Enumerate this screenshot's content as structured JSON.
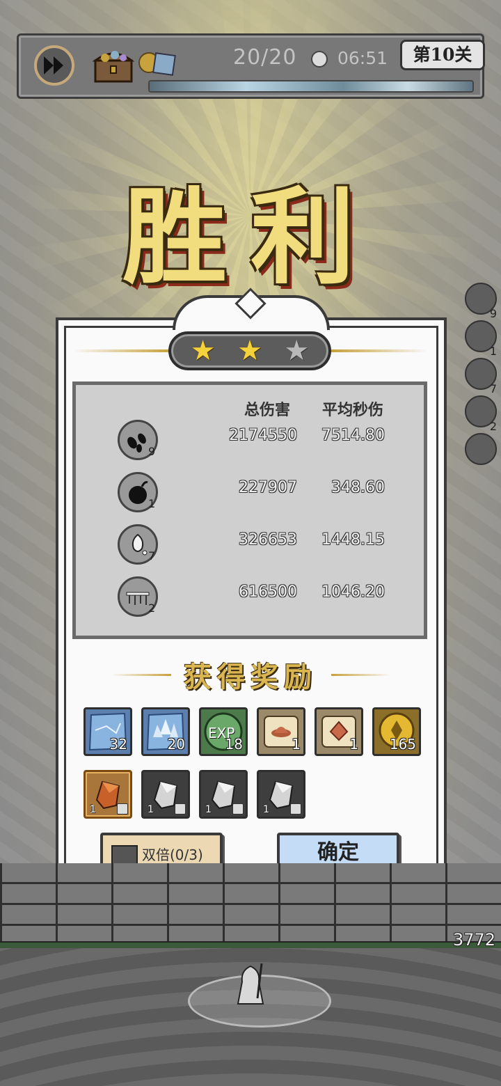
{
  "hud": {
    "wave": "20/20",
    "timer": "06:51",
    "level": "第10关"
  },
  "victory_title": "胜利",
  "stars": {
    "earned": 2,
    "total": 3
  },
  "side_icons": [
    {
      "name": "dark-seeds-skill-icon",
      "level": "9"
    },
    {
      "name": "bomb-skill-icon",
      "level": "1"
    },
    {
      "name": "splash-skill-icon",
      "level": "7"
    },
    {
      "name": "trap-skill-icon",
      "level": "2"
    },
    {
      "name": "rock-skill-icon",
      "level": ""
    }
  ],
  "stats": {
    "header_total": "总伤害",
    "header_dps": "平均秒伤",
    "rows": [
      {
        "icon": "dark-seeds-skill-icon",
        "level": "9",
        "total": "2174550",
        "dps": "7514.80"
      },
      {
        "icon": "bomb-skill-icon",
        "level": "1",
        "total": "227907",
        "dps": "348.60"
      },
      {
        "icon": "splash-skill-icon",
        "level": "7",
        "total": "326653",
        "dps": "1448.15"
      },
      {
        "icon": "trap-skill-icon",
        "level": "2",
        "total": "616500",
        "dps": "1046.20"
      }
    ]
  },
  "rewards_title": "获得奖励",
  "rewards": [
    {
      "name": "blue-crystal-shard-icon",
      "count": "32"
    },
    {
      "name": "blue-crystal-cluster-icon",
      "count": "20"
    },
    {
      "name": "exp-orb-icon",
      "count": "18",
      "label": "EXP"
    },
    {
      "name": "scroll-hat-icon",
      "count": "1"
    },
    {
      "name": "scroll-gem-icon",
      "count": "1"
    },
    {
      "name": "gold-coin-icon",
      "count": "165"
    }
  ],
  "equipment": [
    {
      "name": "orange-ore-icon",
      "count": "1"
    },
    {
      "name": "silver-ore-icon",
      "count": "1"
    },
    {
      "name": "silver-ore-icon",
      "count": "1"
    },
    {
      "name": "silver-ore-icon",
      "count": "1"
    }
  ],
  "buttons": {
    "double": "双倍(0/3)",
    "confirm": "确定"
  },
  "base_hp": "3772",
  "colors": {
    "star_gold": "#f4d23c",
    "confirm_blue": "#c4dcf6",
    "double_beige": "#ecd9b4"
  }
}
